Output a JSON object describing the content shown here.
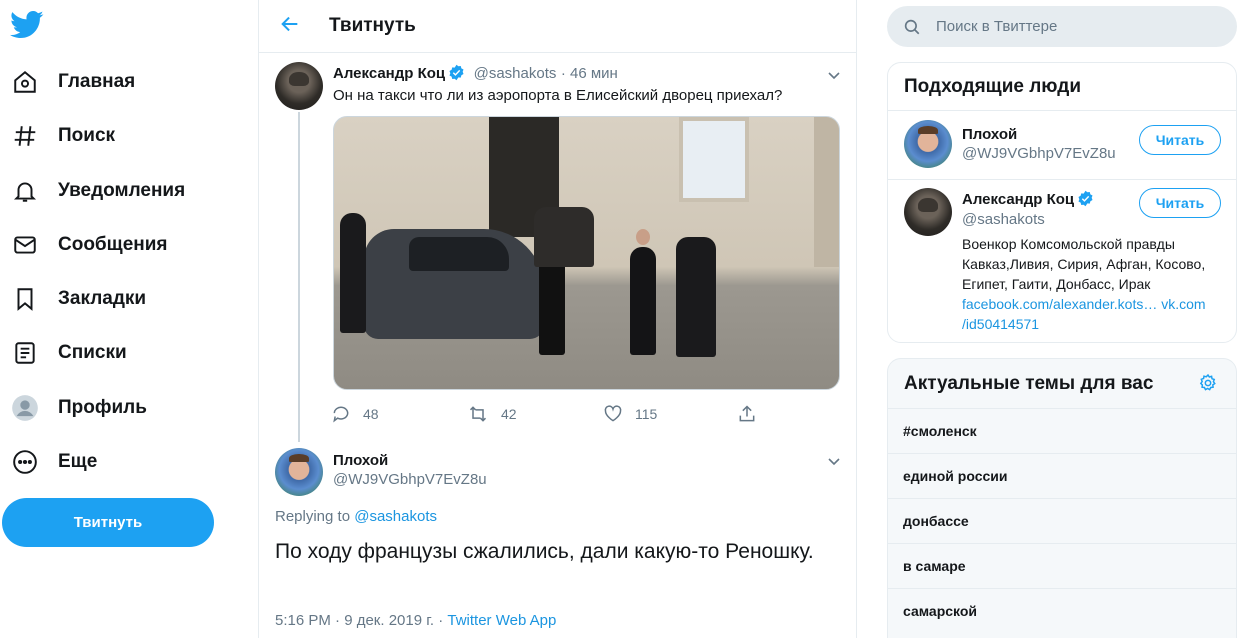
{
  "nav": {
    "items": [
      {
        "label": "Главная",
        "icon": "home-icon"
      },
      {
        "label": "Поиск",
        "icon": "hashtag-icon"
      },
      {
        "label": "Уведомления",
        "icon": "bell-icon"
      },
      {
        "label": "Сообщения",
        "icon": "envelope-icon"
      },
      {
        "label": "Закладки",
        "icon": "bookmark-icon"
      },
      {
        "label": "Списки",
        "icon": "list-icon"
      },
      {
        "label": "Профиль",
        "icon": "user-icon"
      },
      {
        "label": "Еще",
        "icon": "more-icon"
      }
    ],
    "tweet_button": "Твитнуть"
  },
  "header": {
    "title": "Твитнуть"
  },
  "tweet_main": {
    "name": "Александр Коц",
    "handle": "@sashakots",
    "time": "· 46 мин",
    "text": "Он на такси что ли из аэропорта в Елисейский дворец приехал?",
    "replies": "48",
    "retweets": "42",
    "likes": "115"
  },
  "tweet_reply": {
    "name": "Плохой",
    "handle": "@WJ9VGbhpV7EvZ8u",
    "replying_prefix": "Replying to",
    "replying_handle": "@sashakots",
    "text": "По ходу французы сжалились, дали какую-то Реношку.",
    "datetime": "5:16 PM · 9 дек. 2019 г. · ",
    "app": "Twitter Web App"
  },
  "search": {
    "placeholder": "Поиск в Твиттере"
  },
  "who_to_follow": {
    "title": "Подходящие люди",
    "follow_label": "Читать",
    "people": [
      {
        "name": "Плохой",
        "handle": "@WJ9VGbhpV7EvZ8u"
      },
      {
        "name": "Александр Коц",
        "handle": "@sashakots",
        "bio": "Военкор Комсомольской правды Кавказ,Ливия, Сирия, Афган, Косово, Египет, Гаити, Донбасс, Ирак",
        "link1": "facebook.com/alexander.kots…",
        "link2": "vk.com",
        "link3": "/id50414571"
      }
    ]
  },
  "trends": {
    "title": "Актуальные темы для вас",
    "items": [
      "#смоленск",
      "единой россии",
      "донбассе",
      "в самаре",
      "самарской"
    ]
  },
  "colors": {
    "accent": "#1da1f2",
    "link": "#1b95e0",
    "muted": "#657786",
    "border": "#e6ecf0"
  }
}
